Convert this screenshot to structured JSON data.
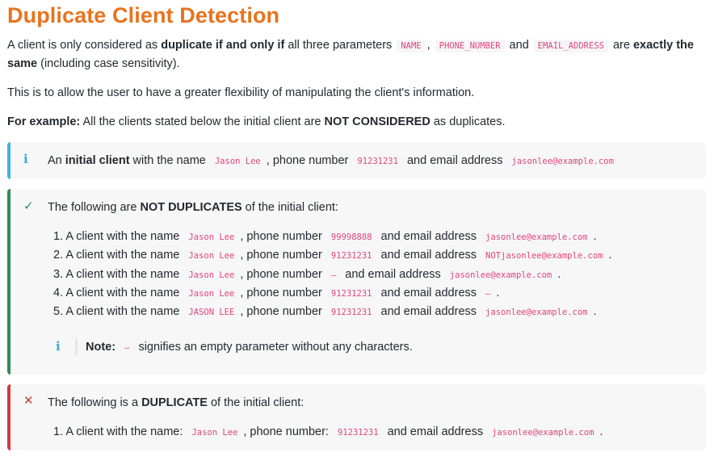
{
  "title": "Duplicate Client Detection",
  "intro": {
    "t1": "A client is only considered as ",
    "b1": "duplicate if and only if",
    "t2": " all three parameters ",
    "c1": "NAME",
    "t3": ", ",
    "c2": "PHONE_NUMBER",
    "t4": " and ",
    "c3": "EMAIL_ADDRESS",
    "t5": " are ",
    "b2": "exactly the same",
    "t6": " (including case sensitivity)."
  },
  "flex_text": "This is to allow the user to have a greater flexibility of manipulating the client's information.",
  "example": {
    "b1": "For example:",
    "t1": " All the clients stated below the initial client are ",
    "b2": "NOT CONSIDERED",
    "t2": " as duplicates."
  },
  "info_callout": {
    "icon": "i",
    "t1": "An ",
    "b1": "initial client",
    "t2": " with the name ",
    "name": "Jason Lee",
    "t3": ", phone number ",
    "phone": "91231231",
    "t4": " and email address ",
    "email": "jasonlee@example.com"
  },
  "not_dup": {
    "icon": "✓",
    "t1": "The following are ",
    "b1": "NOT DUPLICATES",
    "t2": " of the initial client:",
    "items": [
      {
        "n": "1. A client with the name ",
        "name": "Jason Lee",
        "p": ", phone number ",
        "phone": "99998888",
        "e": " and email address ",
        "email": "jasonlee@example.com",
        "end": "."
      },
      {
        "n": "2. A client with the name ",
        "name": "Jason Lee",
        "p": ", phone number ",
        "phone": "91231231",
        "e": " and email address ",
        "email": "NOTjasonlee@example.com",
        "end": "."
      },
      {
        "n": "3. A client with the name ",
        "name": "Jason Lee",
        "p": ", phone number ",
        "phone": "–",
        "e": " and email address ",
        "email": "jasonlee@example.com",
        "end": "."
      },
      {
        "n": "4. A client with the name ",
        "name": "Jason Lee",
        "p": ", phone number ",
        "phone": "91231231",
        "e": " and email address ",
        "email": "–",
        "end": "."
      },
      {
        "n": "5. A client with the name ",
        "name": "JASON LEE",
        "p": ", phone number ",
        "phone": "91231231",
        "e": " and email address ",
        "email": "jasonlee@example.com",
        "end": "."
      }
    ],
    "note": {
      "icon": "i",
      "label": "Note:",
      "dash": "–",
      "text": " signifies an empty parameter without any characters."
    }
  },
  "dup": {
    "icon": "✕",
    "t1": "The following is a ",
    "b1": "DUPLICATE",
    "t2": " of the initial client:",
    "items": [
      {
        "n": "1. A client with the name: ",
        "name": "Jason Lee",
        "p": ", phone number: ",
        "phone": "91231231",
        "e": " and email address ",
        "email": "jasonlee@example.com",
        "end": "."
      }
    ]
  },
  "colors": {
    "title": "#e8731f",
    "code": "#e0457b",
    "info": "#3fb5e0",
    "success": "#2e8b57",
    "danger": "#cf3a43"
  }
}
